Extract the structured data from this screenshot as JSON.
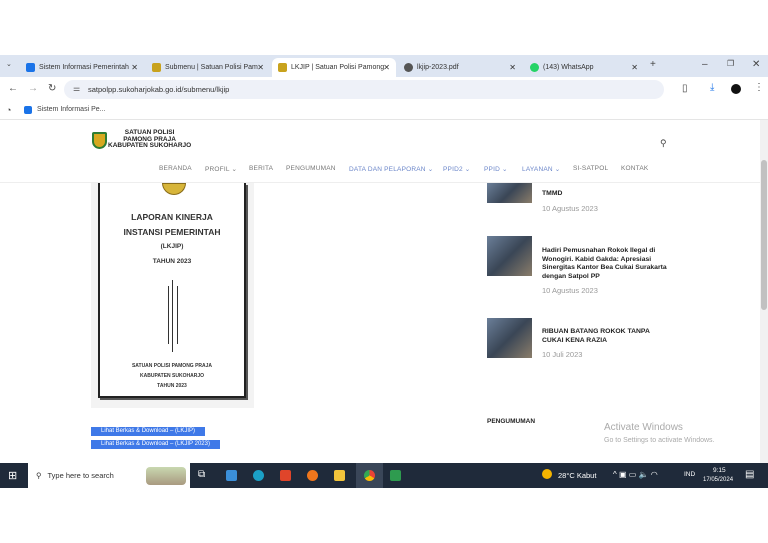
{
  "browser": {
    "tabs": [
      {
        "title": "Sistem Informasi Pemerintah",
        "color": "#1a73e8"
      },
      {
        "title": "Submenu | Satuan Polisi Pam",
        "color": "#c8a21d"
      },
      {
        "title": "LKJIP | Satuan Polisi Pamong",
        "color": "#c8a21d",
        "active": true
      },
      {
        "title": "lkjip-2023.pdf",
        "color": "#555555"
      },
      {
        "title": "(143) WhatsApp",
        "color": "#25d366"
      }
    ],
    "url": "satpolpp.sukoharjokab.go.id/submenu/lkjip",
    "bookmark": "Sistem Informasi Pe..."
  },
  "site": {
    "logo_lines": [
      "SATUAN POLISI",
      "PAMONG PRAJA",
      "KABUPATEN SUKOHARJO"
    ],
    "nav": [
      {
        "label": "BERANDA"
      },
      {
        "label": "PROFIL ⌄"
      },
      {
        "label": "BERITA"
      },
      {
        "label": "PENGUMUMAN"
      },
      {
        "label": "DATA DAN PELAPORAN ⌄",
        "active": true
      },
      {
        "label": "PPID2 ⌄",
        "active": true
      },
      {
        "label": "PPID ⌄",
        "active": true
      },
      {
        "label": "LAYANAN ⌄",
        "active": true
      },
      {
        "label": "SI-SATPOL"
      },
      {
        "label": "KONTAK"
      }
    ]
  },
  "document": {
    "title1": "LAPORAN KINERJA",
    "title2": "INSTANSI PEMERINTAH",
    "abbr": "(LKJIP)",
    "year": "TAHUN 2023",
    "org1": "SATUAN POLISI PAMONG PRAJA",
    "org2": "KABUPATEN SUKOHARJO",
    "org_year": "TAHUN 2023"
  },
  "buttons": [
    {
      "label": "Lihat Berkas & Download – (LKJIP)"
    },
    {
      "label": "Lihat Berkas & Download – (LKJIP 2023)"
    }
  ],
  "news": [
    {
      "title": "TMMD",
      "date": "10 Agustus 2023"
    },
    {
      "title": "Hadiri Pemusnahan Rokok Ilegal di Wonogiri. Kabid Gakda: Apresiasi Sinergitas Kantor Bea Cukai Surakarta dengan Satpol PP",
      "date": "10 Agustus 2023"
    },
    {
      "title": "RIBUAN BATANG ROKOK TANPA CUKAI KENA RAZIA",
      "date": "10 Juli 2023"
    }
  ],
  "section_heading": "PENGUMUMAN",
  "watermark": {
    "title": "Activate Windows",
    "sub": "Go to Settings to activate Windows."
  },
  "taskbar": {
    "search_placeholder": "Type here to search",
    "weather": "28°C  Kabut",
    "lang": "IND",
    "time": "9:15",
    "date": "17/05/2024"
  }
}
